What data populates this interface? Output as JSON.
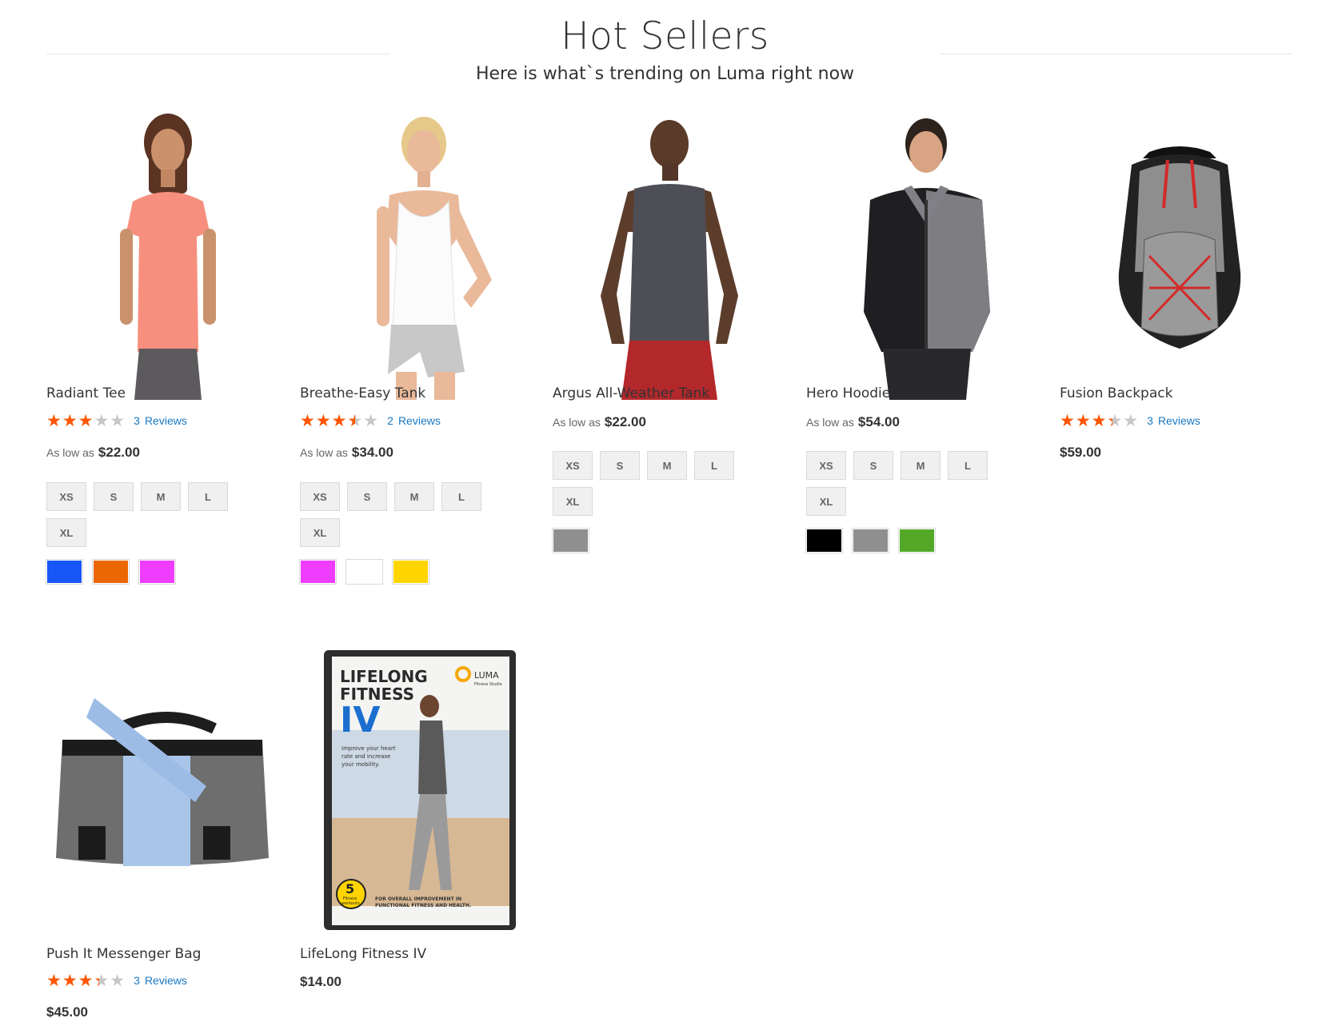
{
  "block": {
    "title": "Hot Sellers",
    "subtitle": "Here is what`s trending on Luma right now"
  },
  "products": [
    {
      "name": "Radiant Tee",
      "rating_percent": 60,
      "review_count": "3",
      "reviews_label": "Reviews",
      "price_prefix": "As low as",
      "price": "$22.00",
      "sizes": [
        "XS",
        "S",
        "M",
        "L",
        "XL"
      ],
      "colors": [
        "#1857f7",
        "#eb6703",
        "#ef3dff"
      ],
      "image": "woman-orange-tee"
    },
    {
      "name": "Breathe-Easy Tank",
      "rating_percent": 70,
      "review_count": "2",
      "reviews_label": "Reviews",
      "price_prefix": "As low as",
      "price": "$34.00",
      "sizes": [
        "XS",
        "S",
        "M",
        "L",
        "XL"
      ],
      "colors": [
        "#ef3dff",
        "#ffffff",
        "#ffd500"
      ],
      "image": "woman-white-tank"
    },
    {
      "name": "Argus All-Weather Tank",
      "price_prefix": "As low as",
      "price": "$22.00",
      "sizes": [
        "XS",
        "S",
        "M",
        "L",
        "XL"
      ],
      "colors": [
        "#8f8f8f"
      ],
      "image": "man-gray-tank"
    },
    {
      "name": "Hero Hoodie",
      "price_prefix": "As low as",
      "price": "$54.00",
      "sizes": [
        "XS",
        "S",
        "M",
        "L",
        "XL"
      ],
      "colors": [
        "#000000",
        "#8f8f8f",
        "#53a828"
      ],
      "image": "man-hoodie"
    },
    {
      "name": "Fusion Backpack",
      "rating_percent": 67,
      "review_count": "3",
      "reviews_label": "Reviews",
      "price": "$59.00",
      "image": "backpack"
    },
    {
      "name": "Push It Messenger Bag",
      "rating_percent": 67,
      "review_count": "3",
      "reviews_label": "Reviews",
      "price": "$45.00",
      "image": "messenger-bag"
    },
    {
      "name": "LifeLong Fitness IV",
      "price": "$14.00",
      "image": "fitness-dvd",
      "dvd": {
        "line1": "LIFELONG",
        "line2": "FITNESS",
        "line3": "IV",
        "brand": "LUMA",
        "brand_sub": "Fitness Studio",
        "blurb1": "Improve your heart",
        "blurb2": "rate and increase",
        "blurb3": "your mobility.",
        "badge_num": "5",
        "badge_text1": "Fitness",
        "badge_text2": "workouts",
        "footer1": "FOR OVERALL IMPROVEMENT IN",
        "footer2": "FUNCTIONAL FITNESS AND HEALTH."
      }
    }
  ]
}
